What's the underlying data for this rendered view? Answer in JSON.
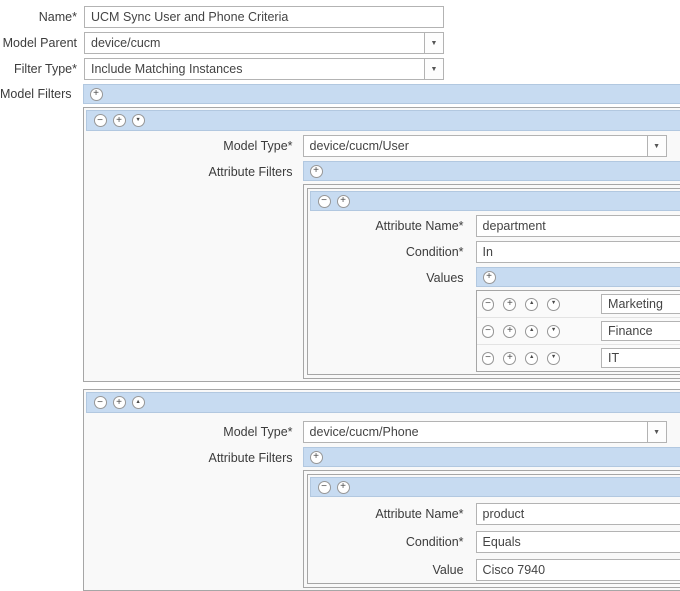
{
  "glyphs": {
    "minus": "−",
    "plus": "+",
    "up": "▲",
    "down": "▼",
    "dropdown": "▼"
  },
  "colors": {
    "bar_blue": "#c7dbf1",
    "panel_border": "#a6a6a6",
    "input_border": "#b3b3b3"
  },
  "fields": {
    "name": {
      "label": "Name*",
      "value": "UCM Sync User and Phone Criteria"
    },
    "model_parent": {
      "label": "Model Parent",
      "value": "device/cucm"
    },
    "filter_type": {
      "label": "Filter Type*",
      "value": "Include Matching Instances"
    },
    "model_filters_label": "Model Filters"
  },
  "panels": [
    {
      "model_type": {
        "label": "Model Type*",
        "value": "device/cucm/User"
      },
      "attribute_filters_label": "Attribute Filters",
      "filter": {
        "attribute_name": {
          "label": "Attribute Name*",
          "value": "department"
        },
        "condition": {
          "label": "Condition*",
          "value": "In"
        },
        "values_label": "Values",
        "values": [
          "Marketing",
          "Finance",
          "IT"
        ]
      }
    },
    {
      "model_type": {
        "label": "Model Type*",
        "value": "device/cucm/Phone"
      },
      "attribute_filters_label": "Attribute Filters",
      "filter": {
        "attribute_name": {
          "label": "Attribute Name*",
          "value": "product"
        },
        "condition": {
          "label": "Condition*",
          "value": "Equals"
        },
        "value_label": "Value",
        "value": "Cisco 7940"
      }
    }
  ]
}
